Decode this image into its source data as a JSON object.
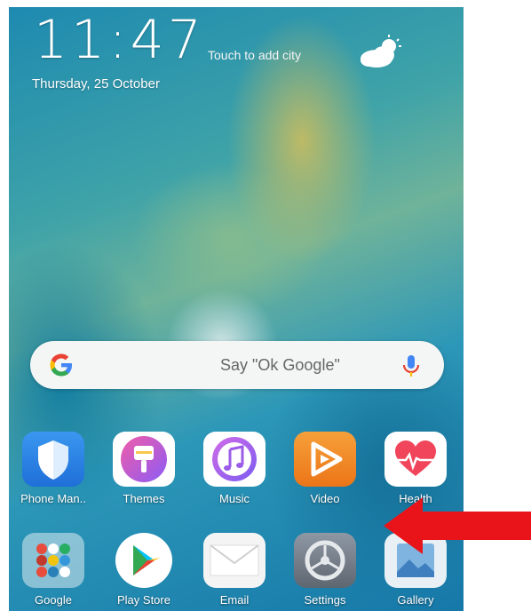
{
  "lockscreen": {
    "time": "11:47",
    "weather_prompt": "Touch to add city",
    "date": "Thursday, 25 October",
    "weather_icon": "partly-cloudy-icon"
  },
  "search": {
    "hint": "Say \"Ok Google\""
  },
  "apps_row1": [
    {
      "label": "Phone Man..",
      "icon": "shield-icon"
    },
    {
      "label": "Themes",
      "icon": "brush-icon"
    },
    {
      "label": "Music",
      "icon": "music-note-icon"
    },
    {
      "label": "Video",
      "icon": "play-icon"
    },
    {
      "label": "Health",
      "icon": "heart-icon"
    }
  ],
  "apps_row2": [
    {
      "label": "Google",
      "icon": "folder-icon"
    },
    {
      "label": "Play Store",
      "icon": "play-store-icon"
    },
    {
      "label": "Email",
      "icon": "envelope-icon"
    },
    {
      "label": "Settings",
      "icon": "gear-icon"
    },
    {
      "label": "Gallery",
      "icon": "gallery-icon"
    }
  ],
  "colors": {
    "arrow": "#e8141a",
    "video": "#f08a24",
    "phone_manager": "#2a7fe0"
  }
}
